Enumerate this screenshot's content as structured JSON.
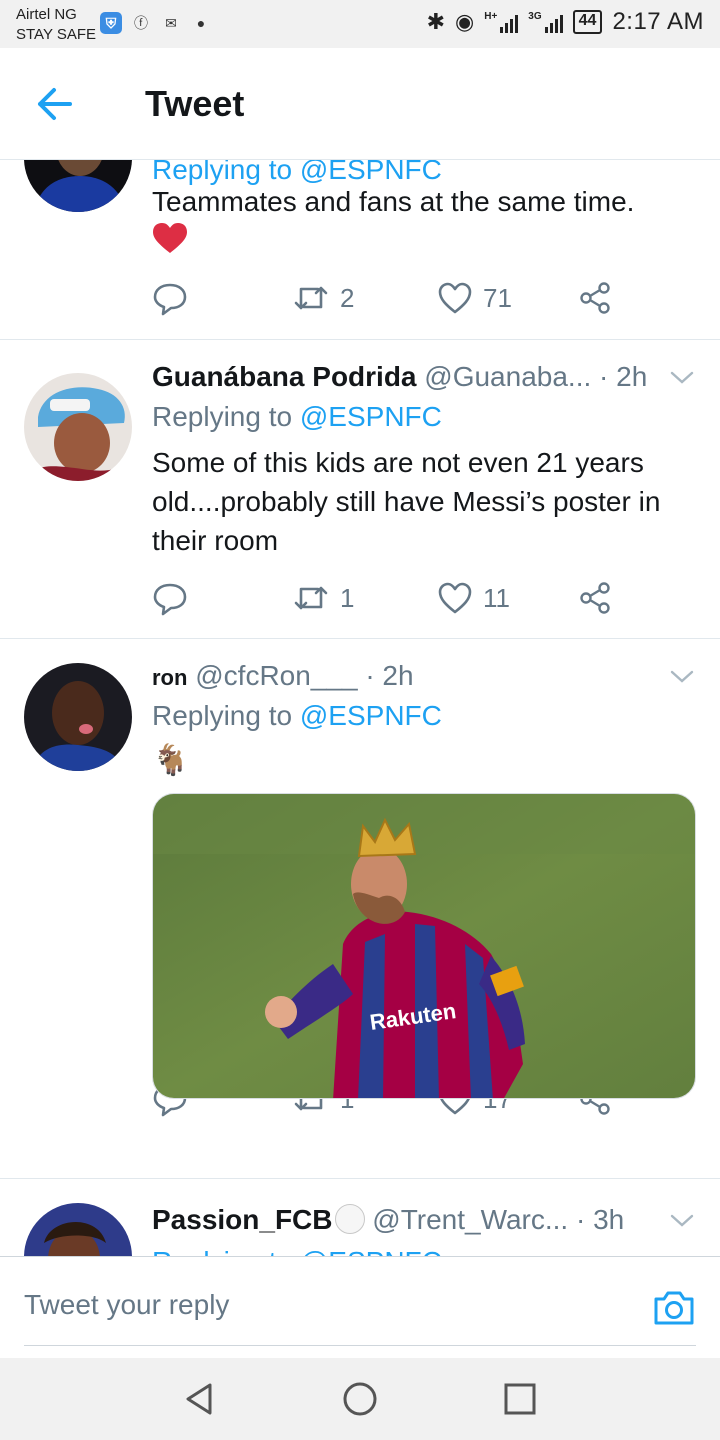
{
  "status_bar": {
    "carrier": "Airtel NG",
    "carrier_sub": "STAY SAFE",
    "net_label_1": "H+",
    "net_label_2": "3G",
    "battery": "44",
    "time": "2:17 AM"
  },
  "header": {
    "title": "Tweet"
  },
  "tweets": [
    {
      "replying_partial": "Replying to @ESPNFC",
      "text": "Teammates and fans at the same time.",
      "emoji": "❤️",
      "replies": "",
      "retweets": "2",
      "likes": "71"
    },
    {
      "name": "Guanábana Podrida",
      "handle": "@Guanaba...",
      "time": "· 2h",
      "replying_prefix": "Replying to ",
      "replying_handle": "@ESPNFC",
      "text": "Some of this kids are not even 21 years old....probably still have Messi’s poster in their room",
      "replies": "",
      "retweets": "1",
      "likes": "11"
    },
    {
      "name": "ron",
      "handle": "@cfcRon___",
      "time": "· 2h",
      "replying_prefix": "Replying to ",
      "replying_handle": "@ESPNFC",
      "emoji": "🐐",
      "media_text": "Rakuten",
      "replies": "",
      "retweets": "1",
      "likes": "17"
    },
    {
      "name": "Passion_FCB",
      "handle": "@Trent_Warc...",
      "time": "· 3h",
      "replying_partial": "Replying to @ESPNFC"
    }
  ],
  "reply_bar": {
    "placeholder": "Tweet your reply"
  },
  "colors": {
    "accent": "#1da1f2",
    "text": "#14171a",
    "muted": "#657786",
    "divider": "#e1e8ed",
    "heart": "#e0245e"
  }
}
